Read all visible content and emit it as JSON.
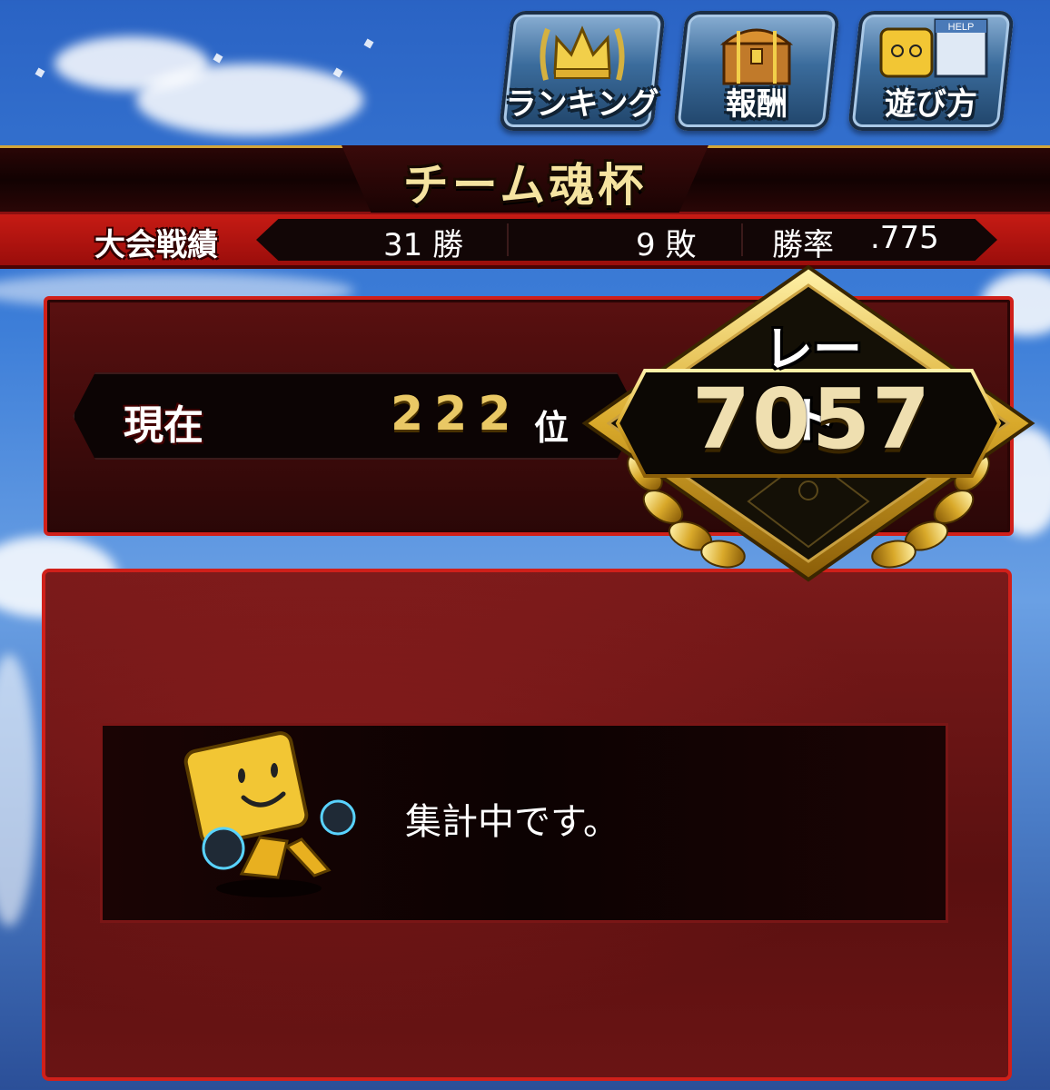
{
  "header": {
    "buttons": [
      {
        "label": "ランキング",
        "icon": "crown-icon"
      },
      {
        "label": "報酬",
        "icon": "treasure-chest-icon"
      },
      {
        "label": "遊び方",
        "icon": "mascot-help-icon",
        "badge": "HELP"
      }
    ]
  },
  "event": {
    "title": "チーム魂杯"
  },
  "record": {
    "label": "大会戦績",
    "wins": "31 勝",
    "losses": "9 敗",
    "win_rate_label": "勝率",
    "win_rate": ".775"
  },
  "rank": {
    "label": "現在",
    "value": "222",
    "unit": "位"
  },
  "rate": {
    "label": "レート",
    "value": "7057"
  },
  "message": {
    "text": "集計中です。"
  },
  "colors": {
    "accent_red": "#d0201a",
    "gold": "#e9c865",
    "sky": "#3d7ed8"
  }
}
